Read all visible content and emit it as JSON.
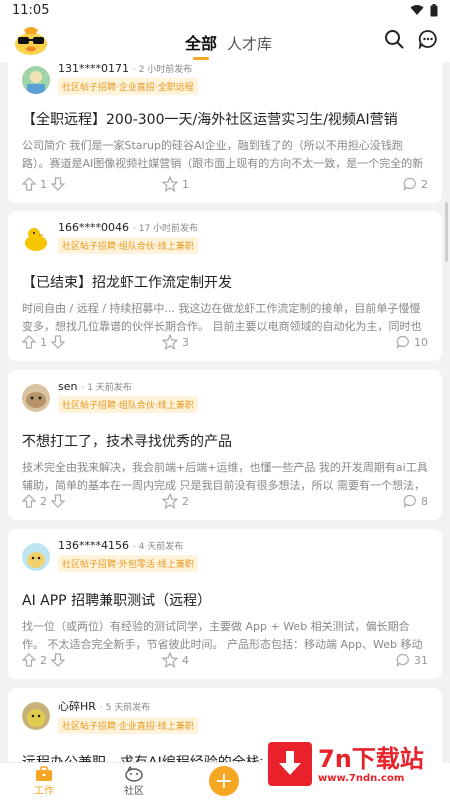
{
  "status": {
    "time": "11:05"
  },
  "header": {
    "tabs": [
      {
        "label": "全部",
        "active": true
      },
      {
        "label": "人才库",
        "active": false
      }
    ]
  },
  "accent_color": "#f5a623",
  "posts": [
    {
      "author": "131****0171",
      "time": "· 2 小时前发布",
      "tag": "社区帖子招聘·企业直招·全职远程",
      "title": "【全职远程】200-300一天/海外社区运营实习生/视频AI营销",
      "desc": "公司简介 我们是一家Starup的硅谷AI企业，融到钱了的（所以不用担心没钱跑路）。赛道是AI图像视频社媒营销（跟市面上现有的方向不太一致，是一个完全的新+宏大的方",
      "likes": "1",
      "stars": "1",
      "comments": "2"
    },
    {
      "author": "166****0046",
      "time": "· 17 小时前发布",
      "tag": "社区帖子招聘·组队合伙·线上兼职",
      "title": "【已结束】招龙虾工作流定制开发",
      "desc": "时间自由 / 远程 / 持续招募中... 我这边在做龙虾工作流定制的接单，目前单子慢慢变多，想找几位靠谱的伙伴长期合作。 目前主要以电商领域的自动化为主，同时也涉及",
      "likes": "1",
      "stars": "3",
      "comments": "10"
    },
    {
      "author": "sen",
      "time": "· 1 天前发布",
      "tag": "社区帖子招聘·组队合伙·线上兼职",
      "title": "不想打工了，技术寻找优秀的产品",
      "desc": "技术完全由我来解决，我会前端+后端+运维，也懂一些产品 我的开发周期有ai工具辅助，简单的基本在一周内完成 只是我目前没有很多想法，所以 需要有一个想法，有市",
      "likes": "2",
      "stars": "2",
      "comments": "8"
    },
    {
      "author": "136****4156",
      "time": "· 4 天前发布",
      "tag": "社区帖子招聘·外包零活·线上兼职",
      "title": "AI APP 招聘兼职测试（远程）",
      "desc": "找一位（或两位）有经验的测试同学，主要做 App + Web 相关测试，偏长期合作。 不太适合完全新手，节省彼此时间。 产品形态包括：移动端 App、Web 移动端、Web 网",
      "likes": "2",
      "stars": "4",
      "comments": "31"
    },
    {
      "author": "心碎HR",
      "time": "· 5 天前发布",
      "tag": "社区帖子招聘·企业直招·线上兼职",
      "title": "远程办公兼职，求有AI编程经验的全栈大佬",
      "desc": "",
      "likes": "",
      "stars": "",
      "comments": ""
    }
  ],
  "bottom_nav": [
    {
      "label": "工作",
      "active": true
    },
    {
      "label": "社区",
      "active": false
    }
  ],
  "watermark": {
    "brand": "7n下载站",
    "url": "www.7ndn.com"
  }
}
